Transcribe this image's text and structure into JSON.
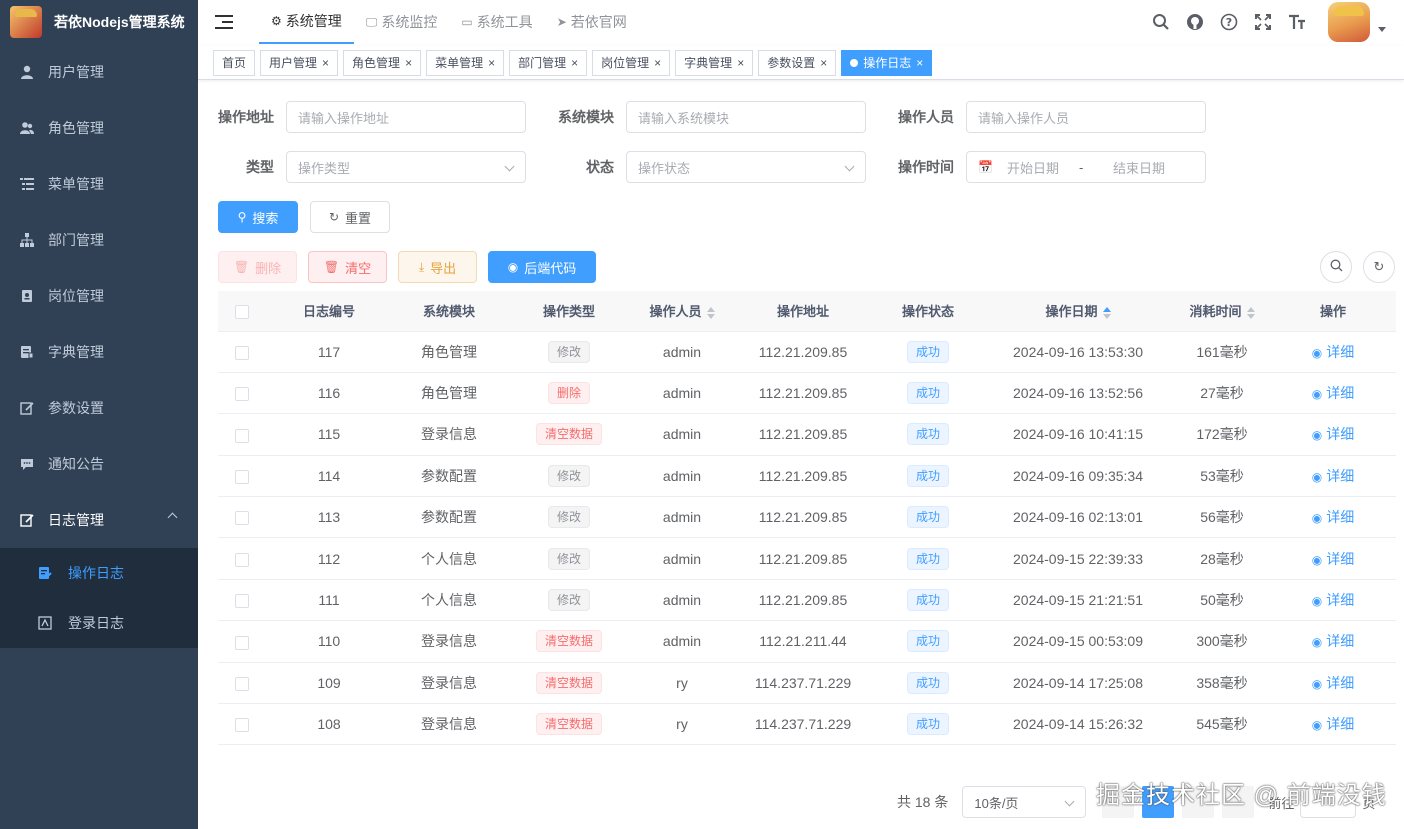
{
  "app": {
    "title": "若依Nodejs管理系统"
  },
  "sidebar": {
    "items": [
      {
        "label": "用户管理",
        "icon": "user-icon"
      },
      {
        "label": "角色管理",
        "icon": "peoples-icon"
      },
      {
        "label": "菜单管理",
        "icon": "tree-table-icon"
      },
      {
        "label": "部门管理",
        "icon": "tree-icon"
      },
      {
        "label": "岗位管理",
        "icon": "post-icon"
      },
      {
        "label": "字典管理",
        "icon": "dict-icon"
      },
      {
        "label": "参数设置",
        "icon": "edit-icon"
      },
      {
        "label": "通知公告",
        "icon": "message-icon"
      },
      {
        "label": "日志管理",
        "icon": "log-icon"
      }
    ],
    "sub_items": [
      {
        "label": "操作日志",
        "icon": "form-icon",
        "active": true
      },
      {
        "label": "登录日志",
        "icon": "logininfor-icon",
        "active": false
      }
    ]
  },
  "topnav": {
    "items": [
      {
        "label": "系统管理",
        "icon": "gear-icon",
        "active": true
      },
      {
        "label": "系统监控",
        "icon": "monitor-icon",
        "active": false
      },
      {
        "label": "系统工具",
        "icon": "toolbox-icon",
        "active": false
      },
      {
        "label": "若依官网",
        "icon": "send-icon",
        "active": false
      }
    ]
  },
  "tags": [
    {
      "label": "首页",
      "closable": false
    },
    {
      "label": "用户管理",
      "closable": true
    },
    {
      "label": "角色管理",
      "closable": true
    },
    {
      "label": "菜单管理",
      "closable": true
    },
    {
      "label": "部门管理",
      "closable": true
    },
    {
      "label": "岗位管理",
      "closable": true
    },
    {
      "label": "字典管理",
      "closable": true
    },
    {
      "label": "参数设置",
      "closable": true
    },
    {
      "label": "操作日志",
      "closable": true,
      "active": true
    }
  ],
  "search": {
    "addr_label": "操作地址",
    "addr_placeholder": "请输入操作地址",
    "module_label": "系统模块",
    "module_placeholder": "请输入系统模块",
    "oper_label": "操作人员",
    "oper_placeholder": "请输入操作人员",
    "type_label": "类型",
    "type_placeholder": "操作类型",
    "status_label": "状态",
    "status_placeholder": "操作状态",
    "time_label": "操作时间",
    "time_start": "开始日期",
    "time_sep": "-",
    "time_end": "结束日期",
    "search_btn": "搜索",
    "reset_btn": "重置"
  },
  "toolbar": {
    "delete": "删除",
    "clean": "清空",
    "export": "导出",
    "backend_code": "后端代码"
  },
  "table": {
    "headers": {
      "id": "日志编号",
      "module": "系统模块",
      "type": "操作类型",
      "oper": "操作人员",
      "addr": "操作地址",
      "status": "操作状态",
      "date": "操作日期",
      "cost": "消耗时间",
      "action": "操作"
    },
    "rows": [
      {
        "id": "117",
        "module": "角色管理",
        "type": "修改",
        "type_style": "info",
        "oper": "admin",
        "addr": "112.21.209.85",
        "status": "成功",
        "date": "2024-09-16 13:53:30",
        "cost": "161毫秒",
        "action": "详细"
      },
      {
        "id": "116",
        "module": "角色管理",
        "type": "删除",
        "type_style": "danger",
        "oper": "admin",
        "addr": "112.21.209.85",
        "status": "成功",
        "date": "2024-09-16 13:52:56",
        "cost": "27毫秒",
        "action": "详细"
      },
      {
        "id": "115",
        "module": "登录信息",
        "type": "清空数据",
        "type_style": "danger",
        "oper": "admin",
        "addr": "112.21.209.85",
        "status": "成功",
        "date": "2024-09-16 10:41:15",
        "cost": "172毫秒",
        "action": "详细"
      },
      {
        "id": "114",
        "module": "参数配置",
        "type": "修改",
        "type_style": "info",
        "oper": "admin",
        "addr": "112.21.209.85",
        "status": "成功",
        "date": "2024-09-16 09:35:34",
        "cost": "53毫秒",
        "action": "详细"
      },
      {
        "id": "113",
        "module": "参数配置",
        "type": "修改",
        "type_style": "info",
        "oper": "admin",
        "addr": "112.21.209.85",
        "status": "成功",
        "date": "2024-09-16 02:13:01",
        "cost": "56毫秒",
        "action": "详细"
      },
      {
        "id": "112",
        "module": "个人信息",
        "type": "修改",
        "type_style": "info",
        "oper": "admin",
        "addr": "112.21.209.85",
        "status": "成功",
        "date": "2024-09-15 22:39:33",
        "cost": "28毫秒",
        "action": "详细"
      },
      {
        "id": "111",
        "module": "个人信息",
        "type": "修改",
        "type_style": "info",
        "oper": "admin",
        "addr": "112.21.209.85",
        "status": "成功",
        "date": "2024-09-15 21:21:51",
        "cost": "50毫秒",
        "action": "详细"
      },
      {
        "id": "110",
        "module": "登录信息",
        "type": "清空数据",
        "type_style": "danger",
        "oper": "admin",
        "addr": "112.21.211.44",
        "status": "成功",
        "date": "2024-09-15 00:53:09",
        "cost": "300毫秒",
        "action": "详细"
      },
      {
        "id": "109",
        "module": "登录信息",
        "type": "清空数据",
        "type_style": "danger",
        "oper": "ry",
        "addr": "114.237.71.229",
        "status": "成功",
        "date": "2024-09-14 17:25:08",
        "cost": "358毫秒",
        "action": "详细"
      },
      {
        "id": "108",
        "module": "登录信息",
        "type": "清空数据",
        "type_style": "danger",
        "oper": "ry",
        "addr": "114.237.71.229",
        "status": "成功",
        "date": "2024-09-14 15:26:32",
        "cost": "545毫秒",
        "action": "详细"
      }
    ]
  },
  "pagination": {
    "total": "共 18 条",
    "page_size": "10条/页",
    "goto_label": "前往",
    "goto_unit": "页"
  },
  "watermark": "掘金技术社区 @ 前端没钱",
  "colors": {
    "sidebar_bg": "#304156",
    "submenu_bg": "#1f2d3d",
    "primary": "#409eff",
    "danger": "#f56c6c",
    "warning": "#e6a23c"
  }
}
